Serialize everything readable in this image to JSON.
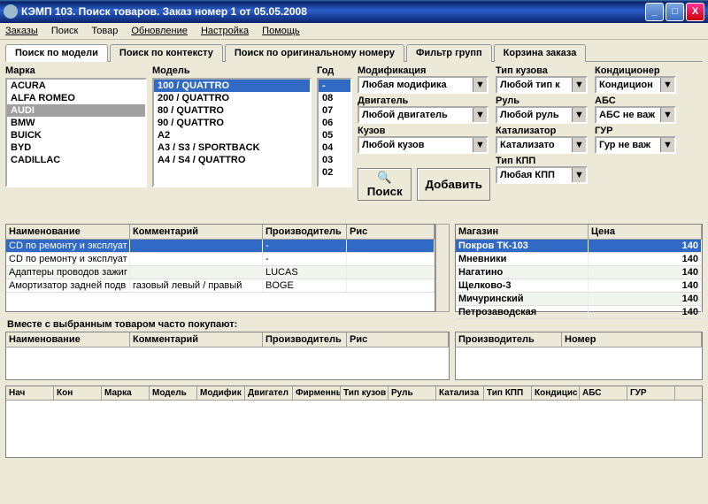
{
  "window": {
    "title": "КЭМП 103. Поиск товаров. Заказ номер 1 от 05.05.2008"
  },
  "menu": {
    "orders": "Заказы",
    "search": "Поиск",
    "product": "Товар",
    "update": "Обновление",
    "settings": "Настройка",
    "help": "Помощь"
  },
  "tabs": {
    "by_model": "Поиск по модели",
    "by_context": "Поиск по контексту",
    "by_oem": "Поиск по оригинальному номеру",
    "group_filter": "Фильтр групп",
    "cart": "Корзина заказа"
  },
  "labels": {
    "brand": "Марка",
    "model": "Модель",
    "year": "Год",
    "modification": "Модификация",
    "body_type": "Тип кузова",
    "ac": "Кондиционер",
    "engine": "Двигатель",
    "steering": "Руль",
    "abs": "АБС",
    "body": "Кузов",
    "catalyst": "Катализатор",
    "gur": "ГУР",
    "kpp": "Тип КПП",
    "search_btn": "Поиск",
    "add_btn": "Добавить",
    "together": "Вместе с выбранным товаром часто покупают:"
  },
  "brands": [
    "ACURA",
    "ALFA ROMEO",
    "AUDI",
    "BMW",
    "BUICK",
    "BYD",
    "CADILLAC"
  ],
  "models": [
    "100 / QUATTRO",
    "200 / QUATTRO",
    "80 / QUATTRO",
    "90 / QUATTRO",
    "A2",
    "A3 / S3 / SPORTBACK",
    "A4 / S4 / QUATTRO"
  ],
  "years": [
    "-",
    "08",
    "07",
    "06",
    "05",
    "04",
    "03",
    "02"
  ],
  "combos": {
    "modification": "Любая модифика",
    "body_type": "Любой тип к",
    "ac": "Кондицион",
    "engine": "Любой двигатель",
    "steering": "Любой руль",
    "abs": "АБС не важ",
    "body": "Любой кузов",
    "catalyst": "Катализато",
    "gur": "Гур не важ",
    "kpp": "Любая КПП"
  },
  "grid1": {
    "h": {
      "name": "Наименование",
      "comment": "Комментарий",
      "maker": "Производитель",
      "pic": "Рис"
    },
    "rows": [
      {
        "name": "CD по ремонту и эксплуат",
        "comment": "",
        "maker": "-",
        "sel": true
      },
      {
        "name": "CD по ремонту и эксплуат",
        "comment": "",
        "maker": "-"
      },
      {
        "name": "Адаптеры проводов зажиг",
        "comment": "",
        "maker": "LUCAS",
        "alt": true
      },
      {
        "name": "Амортизатор задней подв",
        "comment": "газовый  левый / правый",
        "maker": "BOGE"
      }
    ]
  },
  "grid_store": {
    "h": {
      "store": "Магазин",
      "price": "Цена"
    },
    "rows": [
      {
        "store": "Покров ТК-103",
        "price": "140",
        "sel": true
      },
      {
        "store": "Мневники",
        "price": "140"
      },
      {
        "store": "Нагатино",
        "price": "140",
        "alt": true
      },
      {
        "store": "Щелково-3",
        "price": "140"
      },
      {
        "store": "Мичуринский",
        "price": "140",
        "alt": true
      },
      {
        "store": "Петрозаводская",
        "price": "140"
      }
    ]
  },
  "grid_maker": {
    "h": {
      "maker": "Производитель",
      "number": "Номер"
    }
  },
  "botheaders": [
    "Нач",
    "Кон",
    "Марка",
    "Модель",
    "Модифик",
    "Двигател",
    "Фирменнь",
    "Тип кузов",
    "Руль",
    "Катализа",
    "Тип КПП",
    "Кондицис",
    "АБС",
    "ГУР"
  ]
}
